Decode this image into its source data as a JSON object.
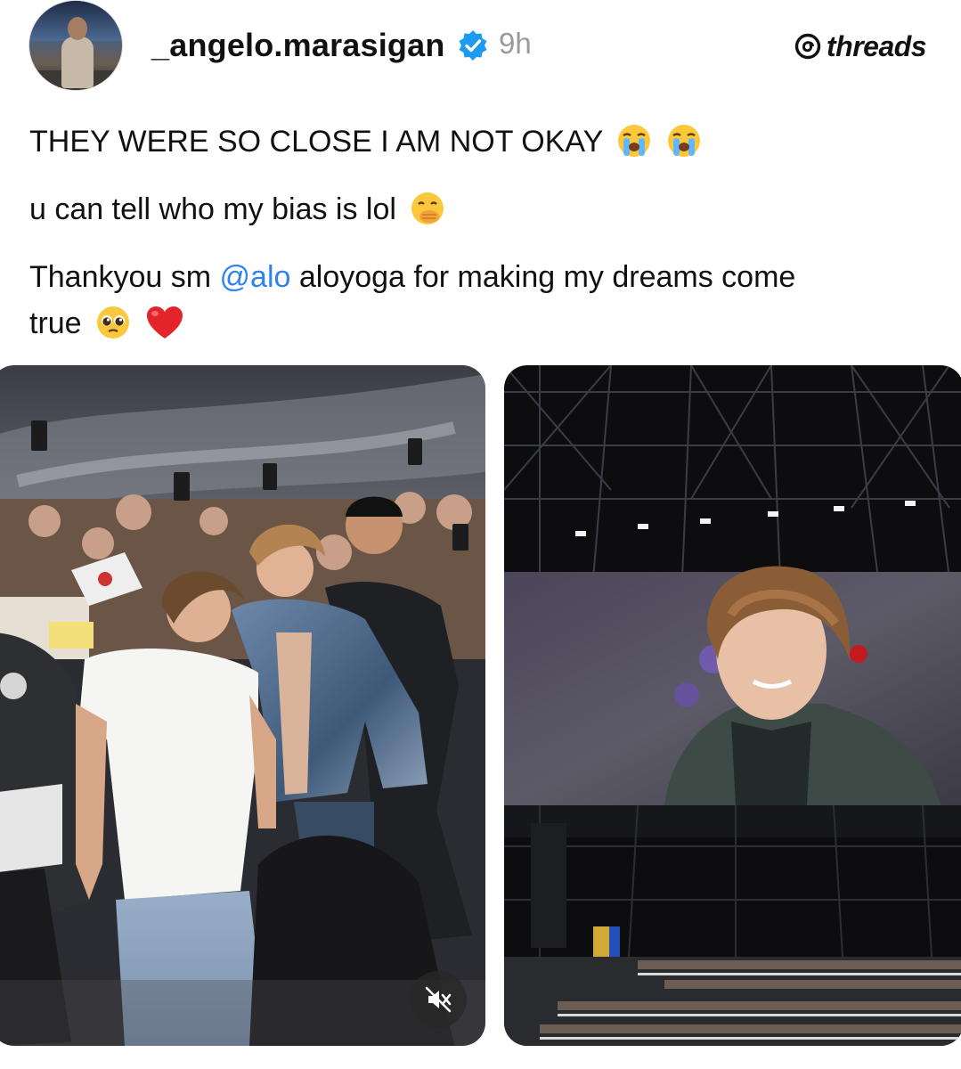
{
  "post": {
    "username": "_angelo.marasigan",
    "verified_icon": "verified-badge-icon",
    "time": "9h",
    "brand": "threads",
    "text": {
      "line1": "THEY WERE SO CLOSE I AM NOT OKAY",
      "line2": "u can tell who my bias is lol",
      "line3_before": "Thankyou sm ",
      "line3_mention": "@alo",
      "line3_after": " aloyoga for making my dreams come",
      "line4": "true"
    },
    "emojis": [
      "loudly-crying-face",
      "loudly-crying-face",
      "face-with-hand-over-mouth",
      "pleading-face",
      "red-heart"
    ]
  },
  "media": [
    {
      "kind": "video",
      "icon": "muted-speaker-icon"
    },
    {
      "kind": "photo"
    }
  ],
  "colors": {
    "mention": "#2f83ef",
    "verified": "#1d9bf0",
    "time": "#9a9a9a"
  }
}
